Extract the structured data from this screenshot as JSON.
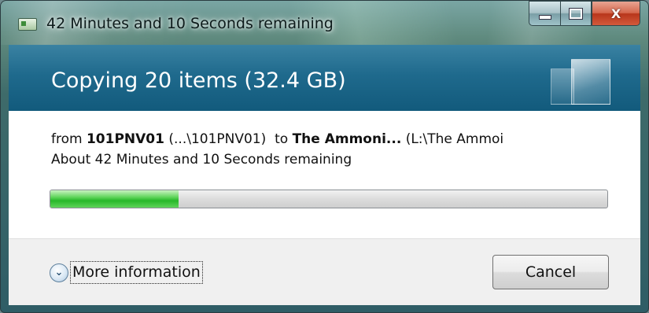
{
  "window": {
    "title": "42 Minutes and 10 Seconds remaining",
    "icons": {
      "app": "copy-dialog-icon",
      "minimize": "minimize-icon",
      "maximize": "maximize-icon",
      "close": "close-icon"
    },
    "close_label": "X"
  },
  "header": {
    "title": "Copying 20 items (32.4 GB)"
  },
  "details": {
    "from_prefix": "from",
    "source_name": "101PNV01",
    "source_path": "(...\\101PNV01)",
    "to_prefix": "to",
    "dest_name": "The Ammoni...",
    "dest_path": "(L:\\The Ammoi",
    "remaining": "About 42 Minutes and 10 Seconds remaining"
  },
  "progress": {
    "fraction": 0.23
  },
  "footer": {
    "more_info_icon": "chevron-down-icon",
    "more_info_label": "More information",
    "cancel_label": "Cancel"
  },
  "colors": {
    "header_bg": "#1f6a8d",
    "progress_green": "#27b829",
    "close_red": "#c9452a"
  }
}
